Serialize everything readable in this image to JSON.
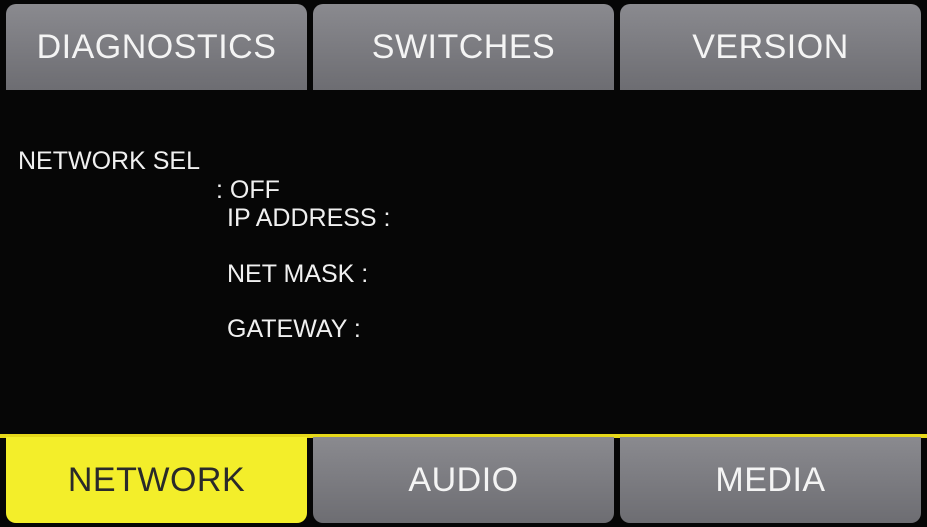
{
  "top_tabs": [
    {
      "label": "DIAGNOSTICS",
      "active": false
    },
    {
      "label": "SWITCHES",
      "active": false
    },
    {
      "label": "VERSION",
      "active": false
    }
  ],
  "bottom_tabs": [
    {
      "label": "NETWORK",
      "active": true
    },
    {
      "label": "AUDIO",
      "active": false
    },
    {
      "label": "MEDIA",
      "active": false
    }
  ],
  "network": {
    "network_sel": {
      "label": "NETWORK SEL",
      "value": ": OFF"
    },
    "ip_address": {
      "label": "IP ADDRESS :",
      "value": ""
    },
    "net_mask": {
      "label": "NET MASK :",
      "value": ""
    },
    "gateway": {
      "label": "GATEWAY :",
      "value": ""
    }
  },
  "colors": {
    "active_tab": "#f3ee2a",
    "inactive_tab": "#7c7c81",
    "background": "#060606",
    "accent_line": "#e6d81a"
  }
}
